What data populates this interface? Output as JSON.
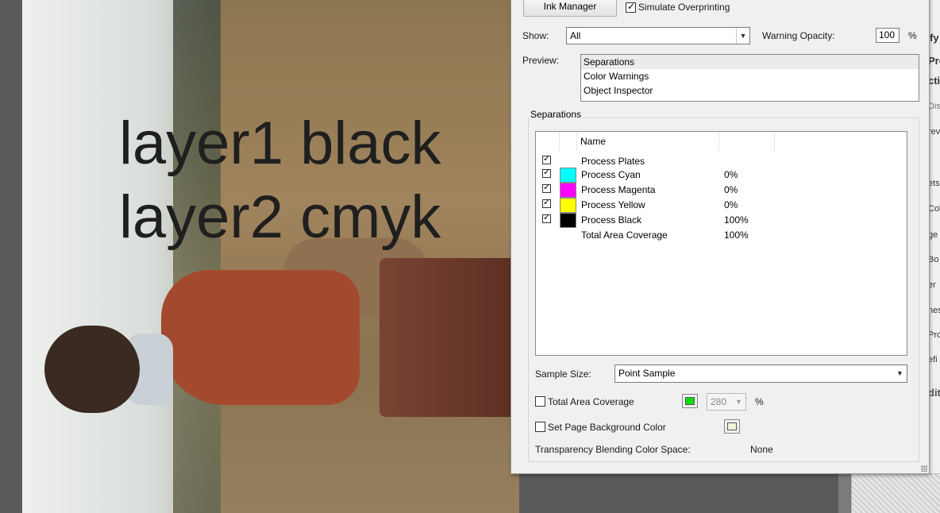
{
  "document": {
    "overlay_line1": "layer1 black",
    "overlay_line2": "layer2 cmyk"
  },
  "right_panel": {
    "items": [
      "fy",
      "Pro",
      "cti",
      "Dist",
      "rev",
      "ets",
      "Col",
      "ge",
      "Bo",
      "er",
      "nes",
      "Pro",
      "efi",
      "dit"
    ]
  },
  "dialog": {
    "ink_manager_label": "Ink Manager",
    "simulate_overprinting_label": "Simulate Overprinting",
    "simulate_overprinting_checked": true,
    "show_label": "Show:",
    "show_value": "All",
    "warning_opacity_label": "Warning Opacity:",
    "warning_opacity_value": "100",
    "warning_opacity_unit": "%",
    "preview_label": "Preview:",
    "preview_options": [
      "Separations",
      "Color Warnings",
      "Object Inspector"
    ],
    "preview_selected": "Separations",
    "separations_group_title": "Separations",
    "table_headers": {
      "name": "Name"
    },
    "separations": [
      {
        "name": "Process Plates",
        "value": "",
        "checked": true,
        "color": ""
      },
      {
        "name": "Process Cyan",
        "value": "0%",
        "checked": true,
        "color": "#00ffff"
      },
      {
        "name": "Process Magenta",
        "value": "0%",
        "checked": true,
        "color": "#ff00ff"
      },
      {
        "name": "Process Yellow",
        "value": "0%",
        "checked": true,
        "color": "#ffff00"
      },
      {
        "name": "Process Black",
        "value": "100%",
        "checked": true,
        "color": "#000000"
      },
      {
        "name": "Total Area Coverage",
        "value": "100%",
        "checked": false,
        "color": ""
      }
    ],
    "sample_size_label": "Sample Size:",
    "sample_size_value": "Point Sample",
    "total_area_coverage_label": "Total Area Coverage",
    "total_area_coverage_checked": false,
    "tac_color": "#00e000",
    "tac_value": "280",
    "tac_unit": "%",
    "set_page_bg_label": "Set Page Background Color",
    "set_page_bg_checked": false,
    "page_bg_color": "#f3f0dc",
    "transparency_label": "Transparency Blending Color Space:",
    "transparency_value": "None"
  }
}
